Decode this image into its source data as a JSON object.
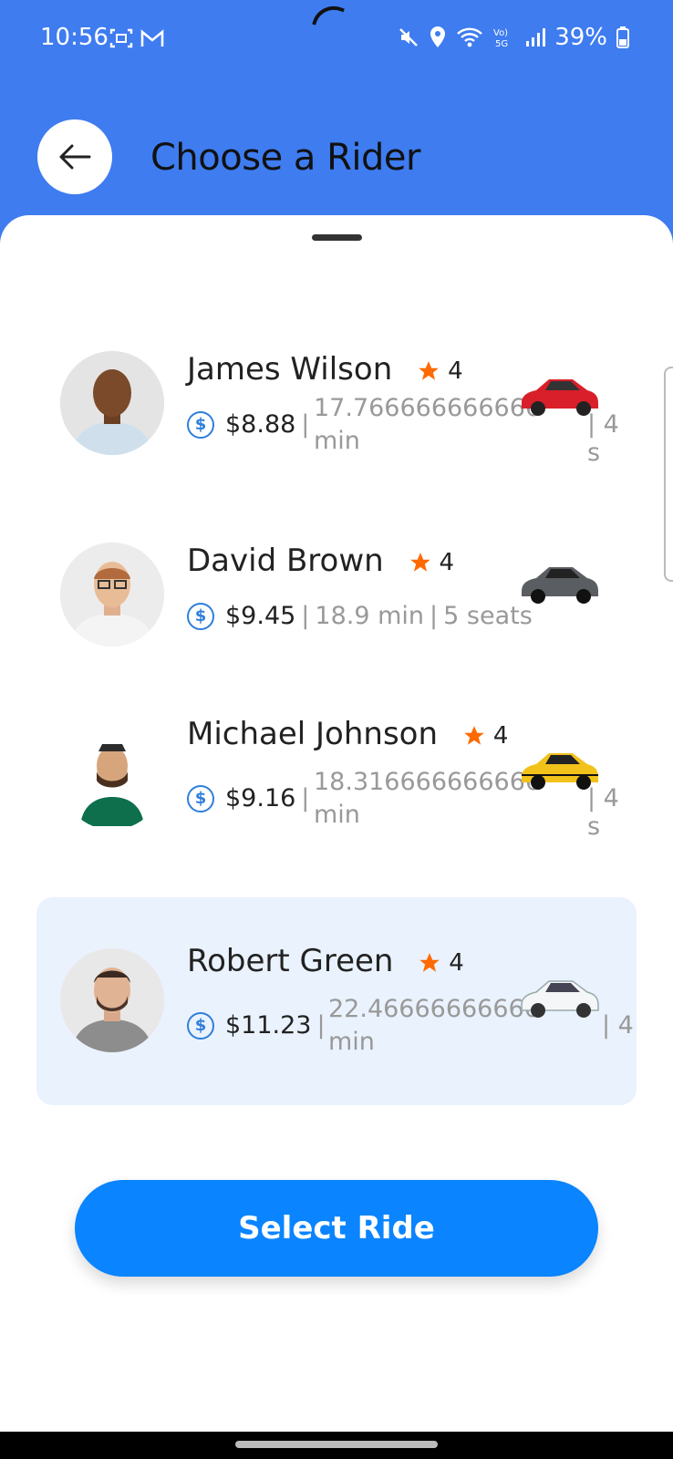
{
  "status": {
    "time": "10:56",
    "battery": "39%"
  },
  "header": {
    "title": "Choose a Rider"
  },
  "riders": [
    {
      "name": "James Wilson",
      "rating": "4",
      "price": "$8.88",
      "duration": "17.7666666666666",
      "duration_unit": "min",
      "tail": "| 4 s"
    },
    {
      "name": "David Brown",
      "rating": "4",
      "price": "$9.45",
      "duration": "18.9 min",
      "seats": "5 seats"
    },
    {
      "name": "Michael Johnson",
      "rating": "4",
      "price": "$9.16",
      "duration": "18.3166666666666",
      "duration_unit": "min",
      "tail": "| 4 s"
    },
    {
      "name": "Robert Green",
      "rating": "4",
      "price": "$11.23",
      "duration": "22.4666666666666",
      "duration_unit": "min",
      "tail": "| 4"
    }
  ],
  "actions": {
    "select_label": "Select Ride"
  },
  "colors": {
    "header_bg": "#3e7cf0",
    "button_bg": "#0a84ff",
    "selected_bg": "#eaf2fd",
    "star": "#ff6a00"
  }
}
